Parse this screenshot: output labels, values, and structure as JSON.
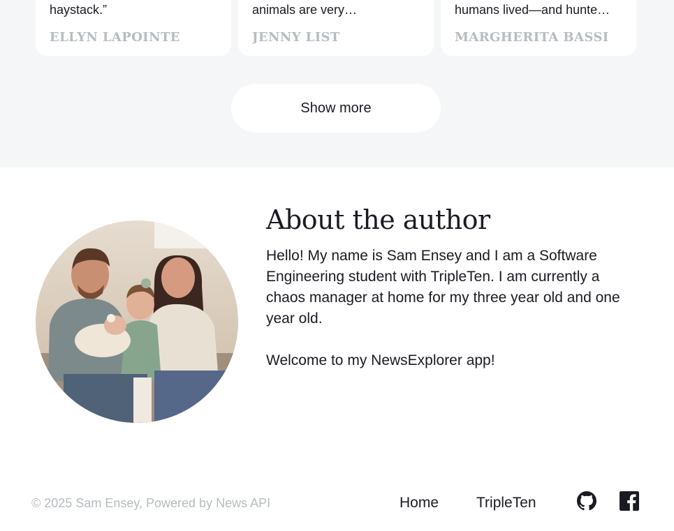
{
  "results": {
    "cards": [
      {
        "snippet": "haystack.”",
        "source": "Ellyn Lapointe"
      },
      {
        "snippet": "animals are very…",
        "source": "Jenny List"
      },
      {
        "snippet": "humans lived—and hunte…",
        "source": "Margherita Bassi"
      }
    ],
    "show_more_label": "Show more"
  },
  "about": {
    "title": "About the author",
    "paragraph_1": "Hello! My name is Sam Ensey and I am a Software Engineering student with TripleTen. I am currently a chaos manager at home for my three year old and one year old.",
    "paragraph_2": "Welcome to my NewsExplorer app!"
  },
  "footer": {
    "copyright": "© 2025 Sam Ensey, Powered by News API",
    "links": {
      "home": "Home",
      "tripleten": "TripleTen"
    },
    "icons": [
      "github-icon",
      "facebook-icon"
    ]
  },
  "colors": {
    "section_bg": "#f5f6f7",
    "text": "#1a1b22",
    "muted": "#b6bcbf"
  }
}
